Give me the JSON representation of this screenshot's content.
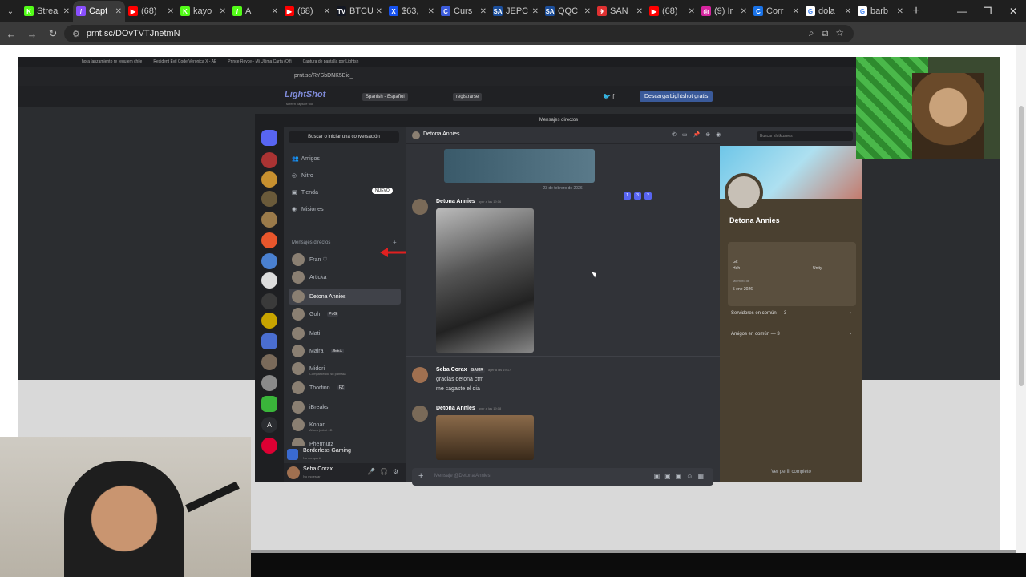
{
  "browser": {
    "tabs": [
      {
        "title": "Strea",
        "fav": "K",
        "color": "#53fc18"
      },
      {
        "title": "Capt",
        "fav": "/",
        "color": "#8a4fff",
        "active": true
      },
      {
        "title": "(68)",
        "fav": "▶",
        "color": "#ff0000"
      },
      {
        "title": "kayo",
        "fav": "K",
        "color": "#53fc18"
      },
      {
        "title": "A",
        "fav": "/",
        "color": "#53fc18"
      },
      {
        "title": "(68)",
        "fav": "▶",
        "color": "#ff0000"
      },
      {
        "title": "BTCU",
        "fav": "TV",
        "color": "#131722"
      },
      {
        "title": "$63,",
        "fav": "X",
        "color": "#1652f0"
      },
      {
        "title": "Curs",
        "fav": "C",
        "color": "#3b5bdb"
      },
      {
        "title": "JEPC",
        "fav": "SA",
        "color": "#1c4f9c"
      },
      {
        "title": "QQC",
        "fav": "SA",
        "color": "#1c4f9c"
      },
      {
        "title": "SAN",
        "fav": "✈",
        "color": "#e03131"
      },
      {
        "title": "(68)",
        "fav": "▶",
        "color": "#ff0000"
      },
      {
        "title": "(9) Ir",
        "fav": "◎",
        "color": "#d6249f"
      },
      {
        "title": "Corr",
        "fav": "C",
        "color": "#1a73e8"
      },
      {
        "title": "dola",
        "fav": "G",
        "color": "#ffffff"
      },
      {
        "title": "barb",
        "fav": "G",
        "color": "#ffffff"
      }
    ],
    "url": "prnt.sc/DOvTVTJnetmN"
  },
  "screenshot": {
    "inner_tabs": [
      "hora lanzamiento re requiem chile",
      "Resident Evil Code Veronica X - AE",
      "Prince Royce - Mi Ultima Carta (Offi",
      "Captura de pantalla por Lightsh"
    ],
    "inner_url": "prnt.sc/RYSbDNK5Bic_",
    "lightshot": {
      "logo": "LightShot",
      "subtitle": "screen capture tool",
      "language": "Spanish - Español",
      "register": "registrarse",
      "download": "Descarga Lightshot gratis"
    }
  },
  "discord": {
    "window_title": "Mensajes directos",
    "search": "Buscar o iniciar una conversación",
    "nav": [
      {
        "label": "Amigos",
        "icon": "👥"
      },
      {
        "label": "Nitro",
        "icon": "◎"
      },
      {
        "label": "Tienda",
        "icon": "▣"
      },
      {
        "label": "Misiones",
        "icon": "◉"
      }
    ],
    "nuevo": "NUEVO",
    "dm_header": "Mensajes directos",
    "dms": [
      {
        "name": "Fran ♡",
        "sub": ""
      },
      {
        "name": "Articka",
        "sub": ""
      },
      {
        "name": "Detona Annies",
        "sub": "",
        "selected": true
      },
      {
        "name": "Goh",
        "tag": "PoG",
        "sub": ""
      },
      {
        "name": "Mati",
        "sub": ""
      },
      {
        "name": "Maira",
        "tag": "JEEX",
        "sub": ""
      },
      {
        "name": "Midori",
        "sub": "Compartiendo su pantalla"
      },
      {
        "name": "Thorfinn",
        "tag": "FZ",
        "sub": ""
      },
      {
        "name": "iBreaks",
        "sub": ""
      },
      {
        "name": "Konan",
        "sub": "Ahora (robot =D"
      },
      {
        "name": "Phermutz",
        "sub": ""
      }
    ],
    "server_bar": {
      "name": "Borderless Gaming",
      "sub": "No compartir"
    },
    "user": {
      "name": "Seba Corax",
      "status": "No molestar"
    },
    "chat": {
      "channel": "Detona Annies",
      "date_divider": "23 de febrero de 2026",
      "messages": [
        {
          "author": "Detona Annies",
          "time": "ayer a las 19:16",
          "text": ""
        },
        {
          "author": "Seba Corax",
          "tag": "GAMR",
          "time": "ayer a las 19:17",
          "lines": [
            "gracias detona ctm",
            "me cagaste el dia"
          ]
        },
        {
          "author": "Detona Annies",
          "time": "ayer a las 19:18",
          "text": ""
        }
      ],
      "input_placeholder": "Mensaje @Detona Annies",
      "reaction_keys": [
        "1",
        "3",
        "2"
      ]
    },
    "header_search": "Buscar shitkusees",
    "profile": {
      "name": "Detona Annies",
      "row1": "Servidores en común — 3",
      "row2": "Amigos en común — 3",
      "footer": "Ver perfil completo",
      "snippets": [
        "Git",
        "Heh",
        "Unity",
        "Miembro de",
        "5 ene 2026"
      ]
    }
  }
}
